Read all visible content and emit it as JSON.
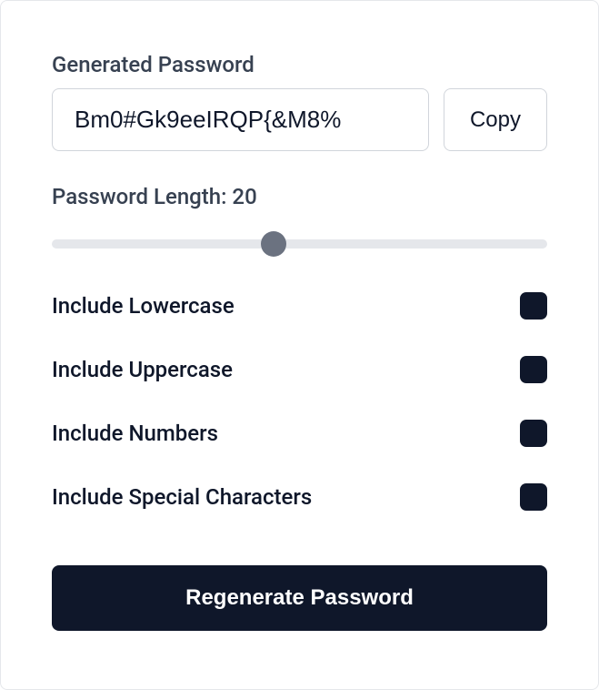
{
  "generated": {
    "label": "Generated Password",
    "value": "Bm0#Gk9eeIRQP{&M8%",
    "copy_label": "Copy"
  },
  "length": {
    "label_prefix": "Password Length: ",
    "value": 20,
    "min": 4,
    "max": 40
  },
  "options": {
    "lowercase": {
      "label": "Include Lowercase",
      "enabled": true
    },
    "uppercase": {
      "label": "Include Uppercase",
      "enabled": true
    },
    "numbers": {
      "label": "Include Numbers",
      "enabled": true
    },
    "special": {
      "label": "Include Special Characters",
      "enabled": true
    }
  },
  "actions": {
    "regenerate_label": "Regenerate Password"
  }
}
